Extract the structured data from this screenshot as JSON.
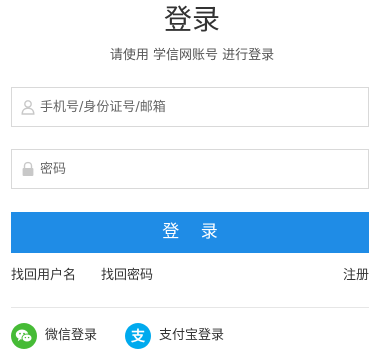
{
  "page": {
    "title": "登录",
    "subtitle": "请使用 学信网账号 进行登录"
  },
  "form": {
    "username_placeholder": "手机号/身份证号/邮箱",
    "username_value": "",
    "password_placeholder": "密码",
    "password_value": "",
    "submit_label": "登 录"
  },
  "links": {
    "find_username": "找回用户名",
    "find_password": "找回密码",
    "register": "注册"
  },
  "social": {
    "wechat_label": "微信登录",
    "alipay_label": "支付宝登录",
    "wechat_icon": "wechat-icon",
    "alipay_icon": "alipay-icon",
    "alipay_glyph": "支"
  },
  "colors": {
    "primary": "#1f8ce6",
    "wechat": "#46bb36",
    "alipay": "#00aaee"
  }
}
